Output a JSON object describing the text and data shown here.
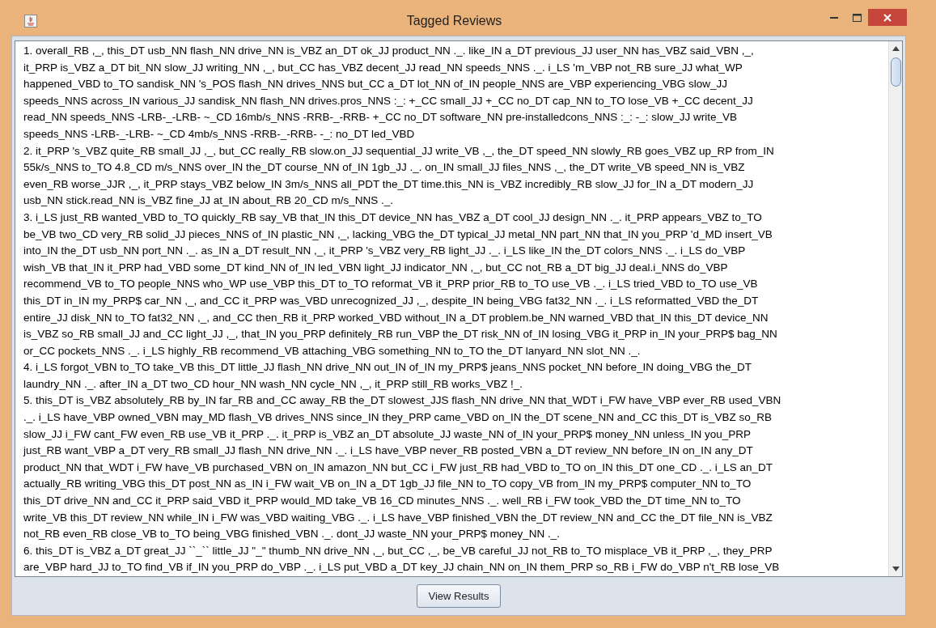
{
  "window": {
    "title": "Tagged Reviews"
  },
  "lines": [
    "1. overall_RB ,_, this_DT usb_NN flash_NN drive_NN is_VBZ an_DT ok_JJ product_NN ._. like_IN a_DT previous_JJ user_NN has_VBZ said_VBN ,_,",
    "it_PRP is_VBZ a_DT bit_NN slow_JJ writing_NN ,_, but_CC has_VBZ decent_JJ read_NN speeds_NNS ._. i_LS 'm_VBP not_RB sure_JJ what_WP",
    "happened_VBD to_TO sandisk_NN 's_POS flash_NN drives_NNS but_CC a_DT lot_NN of_IN people_NNS are_VBP experiencing_VBG slow_JJ",
    "speeds_NNS across_IN various_JJ sandisk_NN flash_NN drives.pros_NNS :_: +_CC small_JJ +_CC no_DT cap_NN to_TO lose_VB +_CC decent_JJ",
    "read_NN speeds_NNS -LRB-_-LRB- ~_CD 16mb/s_NNS -RRB-_-RRB- +_CC no_DT software_NN pre-installedcons_NNS :_: -_: slow_JJ write_VB",
    "speeds_NNS -LRB-_-LRB- ~_CD 4mb/s_NNS -RRB-_-RRB- -_: no_DT led_VBD",
    "2. it_PRP 's_VBZ quite_RB small_JJ ,_, but_CC really_RB slow.on_JJ sequential_JJ write_VB ,_, the_DT speed_NN slowly_RB goes_VBZ up_RP from_IN",
    "55k/s_NNS to_TO 4.8_CD m/s_NNS over_IN the_DT course_NN of_IN 1gb_JJ ._. on_IN small_JJ files_NNS ,_, the_DT write_VB speed_NN is_VBZ",
    "even_RB worse_JJR ,_, it_PRP stays_VBZ below_IN 3m/s_NNS all_PDT the_DT time.this_NN is_VBZ incredibly_RB slow_JJ for_IN a_DT modern_JJ",
    "usb_NN stick.read_NN is_VBZ fine_JJ at_IN about_RB 20_CD m/s_NNS ._.",
    "3. i_LS just_RB wanted_VBD to_TO quickly_RB say_VB that_IN this_DT device_NN has_VBZ a_DT cool_JJ design_NN ._. it_PRP appears_VBZ to_TO",
    "be_VB two_CD very_RB solid_JJ pieces_NNS of_IN plastic_NN ,_, lacking_VBG the_DT typical_JJ metal_NN part_NN that_IN you_PRP 'd_MD insert_VB",
    "into_IN the_DT usb_NN port_NN ._. as_IN a_DT result_NN ,_, it_PRP 's_VBZ very_RB light_JJ ._. i_LS like_IN the_DT colors_NNS ._. i_LS do_VBP",
    "wish_VB that_IN it_PRP had_VBD some_DT kind_NN of_IN led_VBN light_JJ indicator_NN ,_, but_CC not_RB a_DT big_JJ deal.i_NNS do_VBP",
    "recommend_VB to_TO people_NNS who_WP use_VBP this_DT to_TO reformat_VB it_PRP prior_RB to_TO use_VB ._. i_LS tried_VBD to_TO use_VB",
    "this_DT in_IN my_PRP$ car_NN ,_, and_CC it_PRP was_VBD unrecognized_JJ ,_, despite_IN being_VBG fat32_NN ._. i_LS reformatted_VBD the_DT",
    "entire_JJ disk_NN to_TO fat32_NN ,_, and_CC then_RB it_PRP worked_VBD without_IN a_DT problem.be_NN warned_VBD that_IN this_DT device_NN",
    "is_VBZ so_RB small_JJ and_CC light_JJ ,_, that_IN you_PRP definitely_RB run_VBP the_DT risk_NN of_IN losing_VBG it_PRP in_IN your_PRP$ bag_NN",
    "or_CC pockets_NNS ._. i_LS highly_RB recommend_VB attaching_VBG something_NN to_TO the_DT lanyard_NN slot_NN ._.",
    "4. i_LS forgot_VBN to_TO take_VB this_DT little_JJ flash_NN drive_NN out_IN of_IN my_PRP$ jeans_NNS pocket_NN before_IN doing_VBG the_DT",
    "laundry_NN ._. after_IN a_DT two_CD hour_NN wash_NN cycle_NN ,_, it_PRP still_RB works_VBZ !_.",
    "5. this_DT is_VBZ absolutely_RB by_IN far_RB and_CC away_RB the_DT slowest_JJS flash_NN drive_NN that_WDT i_FW have_VBP ever_RB used_VBN",
    "._. i_LS have_VBP owned_VBN may_MD flash_VB drives_NNS since_IN they_PRP came_VBD on_IN the_DT scene_NN and_CC this_DT is_VBZ so_RB",
    "slow_JJ i_FW cant_FW even_RB use_VB it_PRP ._. it_PRP is_VBZ an_DT absolute_JJ waste_NN of_IN your_PRP$ money_NN unless_IN you_PRP",
    "just_RB want_VBP a_DT very_RB small_JJ flash_NN drive_NN ._. i_LS have_VBP never_RB posted_VBN a_DT review_NN before_IN on_IN any_DT",
    "product_NN that_WDT i_FW have_VB purchased_VBN on_IN amazon_NN but_CC i_FW just_RB had_VBD to_TO on_IN this_DT one_CD ._. i_LS an_DT",
    "actually_RB writing_VBG this_DT post_NN as_IN i_FW wait_VB on_IN a_DT 1gb_JJ file_NN to_TO copy_VB from_IN my_PRP$ computer_NN to_TO",
    "this_DT drive_NN and_CC it_PRP said_VBD it_PRP would_MD take_VB 16_CD minutes_NNS ._. well_RB i_FW took_VBD the_DT time_NN to_TO",
    "write_VB this_DT review_NN while_IN i_FW was_VBD waiting_VBG ._. i_LS have_VBP finished_VBN the_DT review_NN and_CC the_DT file_NN is_VBZ",
    "not_RB even_RB close_VB to_TO being_VBG finished_VBN ._. dont_JJ waste_NN your_PRP$ money_NN ._.",
    "6. this_DT is_VBZ a_DT great_JJ ``_`` little_JJ \"_\" thumb_NN drive_NN ,_, but_CC ,_, be_VB careful_JJ not_RB to_TO misplace_VB it_PRP ,_, they_PRP",
    "are_VBP hard_JJ to_TO find_VB if_IN you_PRP do_VBP ._. i_LS put_VBD a_DT key_JJ chain_NN on_IN them_PRP so_RB i_FW do_VBP n't_RB lose_VB"
  ],
  "buttons": [
    "View Results"
  ]
}
